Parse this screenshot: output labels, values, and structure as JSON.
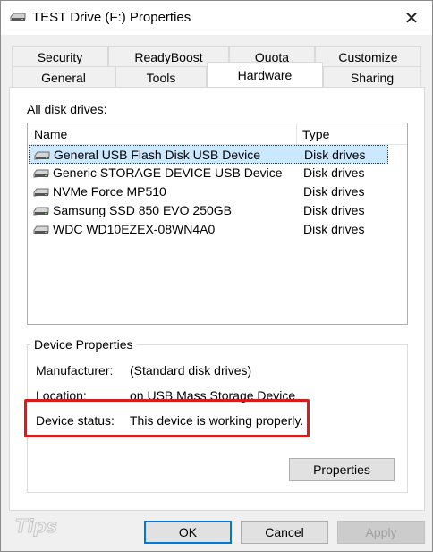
{
  "window": {
    "title": "TEST Drive (F:) Properties",
    "close_glyph": "✕"
  },
  "tabs": {
    "row1": [
      "Security",
      "ReadyBoost",
      "Quota",
      "Customize"
    ],
    "row2": [
      "General",
      "Tools",
      "Hardware",
      "Sharing"
    ],
    "active": "Hardware"
  },
  "hardware": {
    "all_drives_label": "All disk drives:",
    "columns": {
      "name": "Name",
      "type": "Type"
    },
    "rows": [
      {
        "name": "General USB Flash Disk USB Device",
        "type": "Disk drives",
        "selected": true
      },
      {
        "name": "Generic STORAGE DEVICE USB Device",
        "type": "Disk drives",
        "selected": false
      },
      {
        "name": "NVMe Force MP510",
        "type": "Disk drives",
        "selected": false
      },
      {
        "name": "Samsung SSD 850 EVO 250GB",
        "type": "Disk drives",
        "selected": false
      },
      {
        "name": "WDC WD10EZEX-08WN4A0",
        "type": "Disk drives",
        "selected": false
      }
    ]
  },
  "device_properties": {
    "group_title": "Device Properties",
    "manufacturer_label": "Manufacturer:",
    "manufacturer_value": "(Standard disk drives)",
    "location_label": "Location:",
    "location_value": "on USB Mass Storage Device",
    "status_label": "Device status:",
    "status_value": "This device is working properly.",
    "properties_button": "Properties",
    "highlight_color": "#d81c1c"
  },
  "footer": {
    "ok": "OK",
    "cancel": "Cancel",
    "apply": "Apply"
  },
  "watermark_text": "Tips",
  "colors": {
    "selection": "#cce8ff",
    "default_button_border": "#0078d7"
  }
}
